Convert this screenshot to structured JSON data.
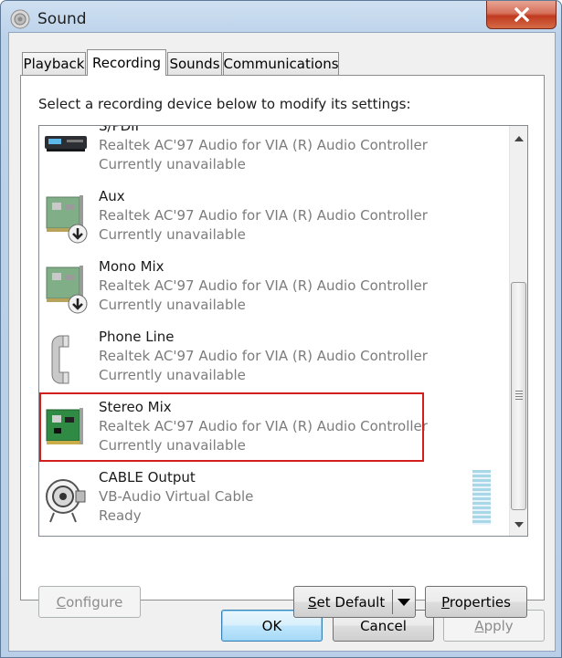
{
  "window": {
    "title": "Sound",
    "icons": {
      "app": "speaker-icon",
      "close": "close-icon"
    }
  },
  "tabs": [
    {
      "label": "Playback"
    },
    {
      "label": "Recording",
      "active": true
    },
    {
      "label": "Sounds"
    },
    {
      "label": "Communications"
    }
  ],
  "recording": {
    "instruction": "Select a recording device below to modify its settings:",
    "devices": [
      {
        "name": "S/PDIF",
        "driver": "Realtek AC'97 Audio for VIA (R) Audio Controller",
        "status": "Currently unavailable",
        "icon": "spdif-device-icon"
      },
      {
        "name": "Aux",
        "driver": "Realtek AC'97 Audio for VIA (R) Audio Controller",
        "status": "Currently unavailable",
        "icon": "sound-card-disabled-icon"
      },
      {
        "name": "Mono Mix",
        "driver": "Realtek AC'97 Audio for VIA (R) Audio Controller",
        "status": "Currently unavailable",
        "icon": "sound-card-disabled-icon"
      },
      {
        "name": "Phone Line",
        "driver": "Realtek AC'97 Audio for VIA (R) Audio Controller",
        "status": "Currently unavailable",
        "icon": "phone-handset-icon"
      },
      {
        "name": "Stereo Mix",
        "driver": "Realtek AC'97 Audio for VIA (R) Audio Controller",
        "status": "Currently unavailable",
        "icon": "sound-card-icon"
      },
      {
        "name": "CABLE Output",
        "driver": "VB-Audio Virtual Cable",
        "status": "Ready",
        "icon": "cable-connector-icon"
      }
    ],
    "highlight_color": "#d31e1e"
  },
  "buttons": {
    "configure": "Configure",
    "set_default": "Set Default",
    "properties": "Properties",
    "ok": "OK",
    "cancel": "Cancel",
    "apply": "Apply"
  }
}
